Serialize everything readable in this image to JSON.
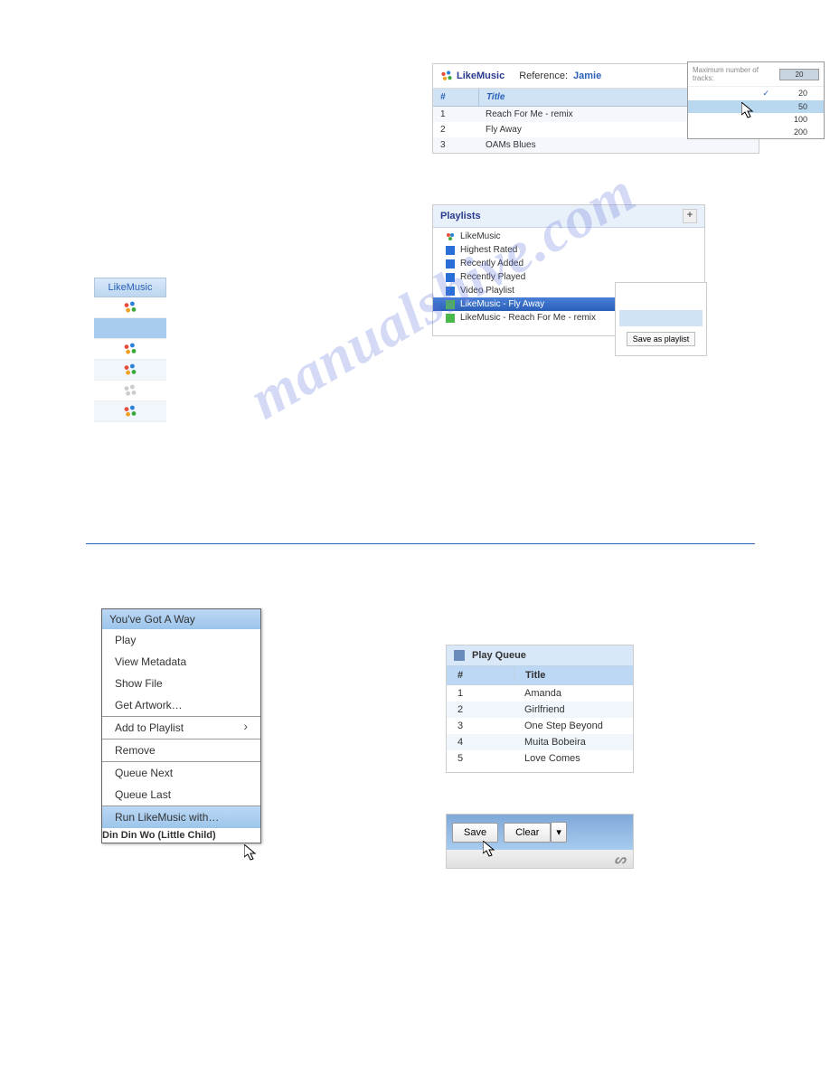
{
  "watermark": "manualshive.com",
  "likemusic_panel": {
    "logo_text": "LikeMusic",
    "reference_label": "Reference:",
    "reference_value": "Jamie",
    "dropdown_label": "Maximum number of tracks:",
    "dropdown_selected": "20",
    "options": [
      "20",
      "50",
      "100",
      "200"
    ],
    "columns": {
      "num": "#",
      "title": "Title"
    },
    "tracks": [
      {
        "n": "1",
        "title": "Reach For Me - remix"
      },
      {
        "n": "2",
        "title": "Fly Away"
      },
      {
        "n": "3",
        "title": "OAMs Blues"
      }
    ]
  },
  "playlists_panel": {
    "header": "Playlists",
    "plus": "+",
    "items": [
      {
        "label": "LikeMusic",
        "icon": "lm"
      },
      {
        "label": "Highest Rated",
        "icon": "blue"
      },
      {
        "label": "Recently Added",
        "icon": "blue"
      },
      {
        "label": "Recently Played",
        "icon": "blue"
      },
      {
        "label": "Video Playlist",
        "icon": "blue"
      },
      {
        "label": "LikeMusic - Fly Away",
        "icon": "green",
        "selected": true
      },
      {
        "label": "LikeMusic - Reach For Me - remix",
        "icon": "green"
      }
    ],
    "save_as_playlist": "Save as playlist"
  },
  "lm_column": {
    "header": "LikeMusic"
  },
  "context_menu": {
    "title": "You've Got A Way",
    "items": [
      "Play",
      "View Metadata",
      "Show File",
      "Get Artwork…",
      "---",
      "Add to Playlist",
      "---",
      "Remove",
      "---",
      "Queue Next",
      "Queue Last",
      "---",
      "Run LikeMusic with…"
    ],
    "behind_text": "Din Din Wo (Little Child)"
  },
  "play_queue": {
    "header": "Play Queue",
    "columns": {
      "num": "#",
      "title": "Title"
    },
    "rows": [
      {
        "n": "1",
        "title": "Amanda"
      },
      {
        "n": "2",
        "title": "Girlfriend"
      },
      {
        "n": "3",
        "title": "One Step Beyond"
      },
      {
        "n": "4",
        "title": "Muita Bobeira"
      },
      {
        "n": "5",
        "title": "Love Comes"
      }
    ]
  },
  "save_clear": {
    "save": "Save",
    "clear": "Clear",
    "dropdown_arrow": "▾"
  }
}
